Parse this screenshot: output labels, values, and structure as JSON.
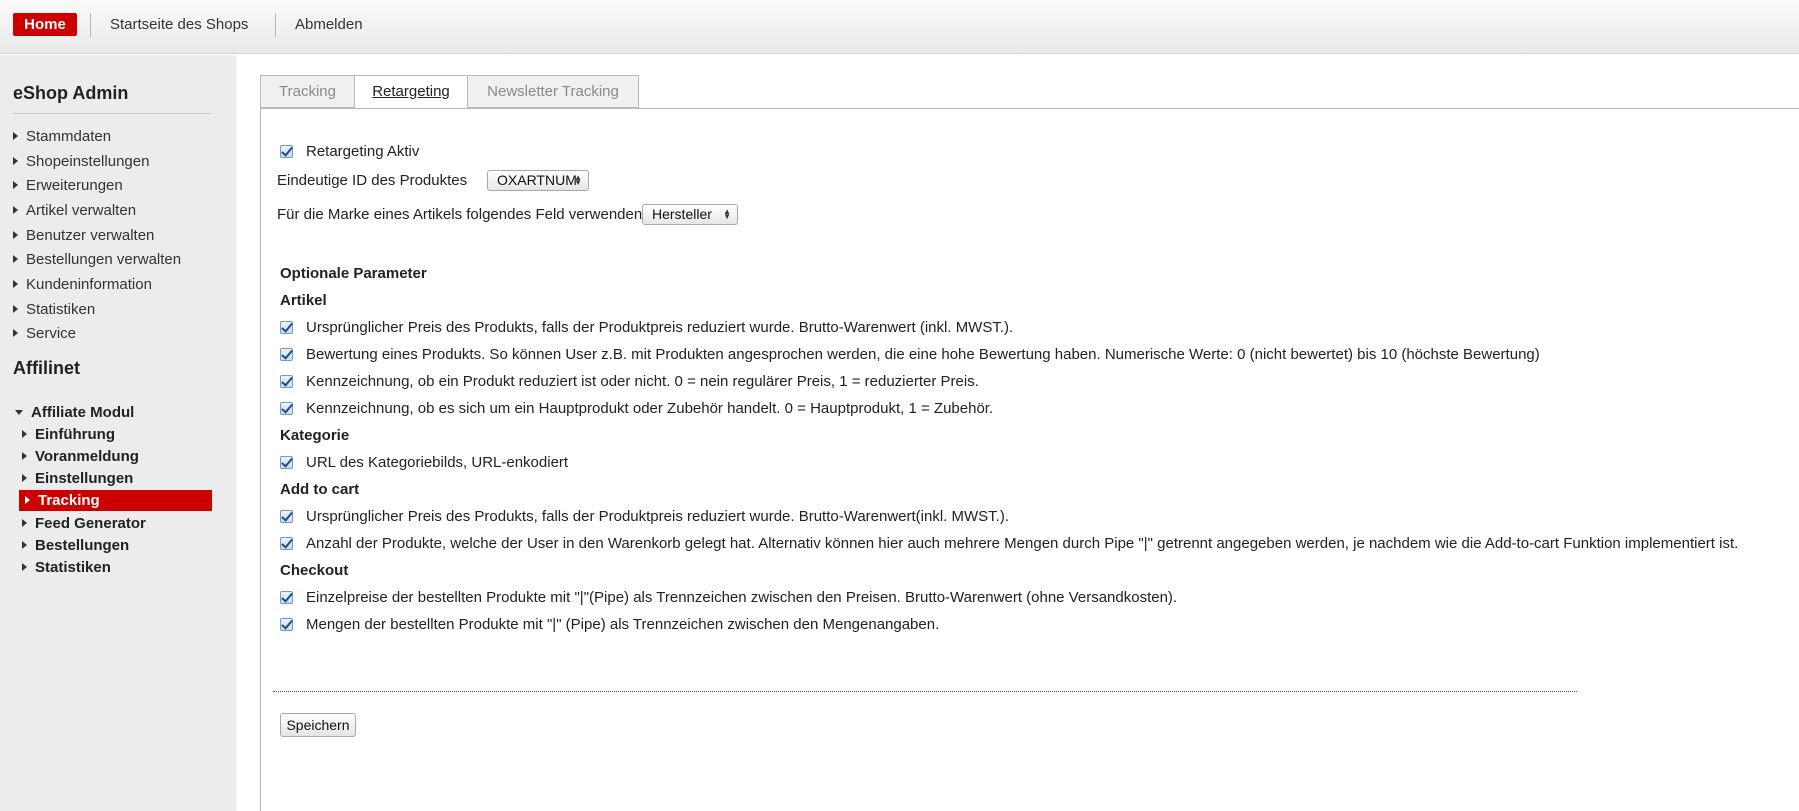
{
  "topbar": {
    "home": "Home",
    "shop_home": "Startseite des Shops",
    "logout": "Abmelden"
  },
  "sidebar": {
    "brand": "eShop Admin",
    "items": [
      "Stammdaten",
      "Shopeinstellungen",
      "Erweiterungen",
      "Artikel verwalten",
      "Benutzer verwalten",
      "Bestellungen verwalten",
      "Kundeninformation",
      "Statistiken",
      "Service"
    ],
    "section": "Affilinet",
    "module": "Affiliate Modul",
    "subitems": [
      "Einführung",
      "Voranmeldung",
      "Einstellungen",
      "Tracking",
      "Feed Generator",
      "Bestellungen",
      "Statistiken"
    ],
    "active_subitem": "Tracking"
  },
  "tabs": [
    "Tracking",
    "Retargeting",
    "Newsletter Tracking"
  ],
  "active_tab": "Retargeting",
  "form": {
    "retargeting_active": "Retargeting Aktiv",
    "product_id_label": "Eindeutige ID des Produktes",
    "product_id_value": "OXARTNUM",
    "brand_field_label": "Für die Marke eines Artikels folgendes Feld verwenden",
    "brand_field_value": "Hersteller",
    "optional_heading": "Optionale Parameter",
    "artikel_heading": "Artikel",
    "artikel_items": [
      "Ursprünglicher Preis des Produkts, falls der Produktpreis reduziert wurde. Brutto-Warenwert (inkl. MWST.).",
      "Bewertung eines Produkts. So können User z.B. mit Produkten angesprochen werden, die eine hohe Bewertung haben. Numerische Werte: 0 (nicht bewertet) bis 10 (höchste Bewertung)",
      "Kennzeichnung, ob ein Produkt reduziert ist oder nicht. 0 = nein regulärer Preis, 1 = reduzierter Preis.",
      "Kennzeichnung, ob es sich um ein Hauptprodukt oder Zubehör handelt. 0 = Hauptprodukt, 1 = Zubehör."
    ],
    "kategorie_heading": "Kategorie",
    "kategorie_items": [
      "URL des Kategoriebilds, URL-enkodiert"
    ],
    "cart_heading": "Add to cart",
    "cart_items": [
      "Ursprünglicher Preis des Produkts, falls der Produktpreis reduziert wurde. Brutto-Warenwert(inkl. MWST.).",
      "Anzahl der Produkte, welche der User in den Warenkorb gelegt hat. Alternativ können hier auch mehrere Mengen durch Pipe \"|\" getrennt angegeben werden, je nachdem wie die Add-to-cart Funktion implementiert ist."
    ],
    "checkout_heading": "Checkout",
    "checkout_items": [
      "Einzelpreise der bestellten Produkte mit \"|\"(Pipe) als Trennzeichen zwischen den Preisen. Brutto-Warenwert (ohne Versandkosten).",
      "Mengen der bestellten Produkte mit \"|\" (Pipe) als Trennzeichen zwischen den Mengenangaben."
    ],
    "save_label": "Speichern"
  },
  "colors": {
    "accent": "#cc0000",
    "sidebar_bg": "#ececec",
    "checkbox_mark": "#1f4d85"
  }
}
